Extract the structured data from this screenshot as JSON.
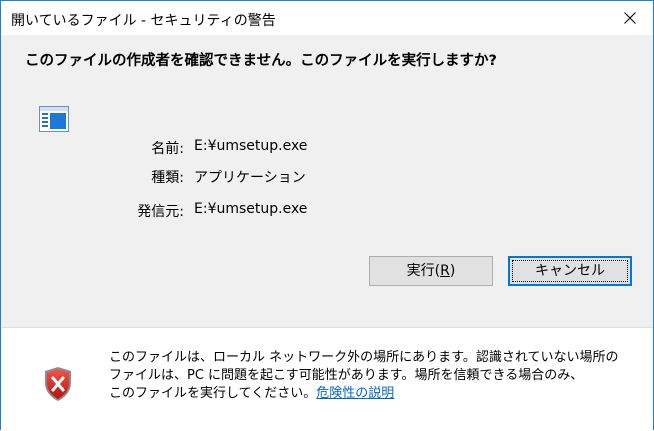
{
  "window": {
    "title": "開いているファイル - セキュリティの警告",
    "close_glyph": "✕"
  },
  "main": {
    "question": "このファイルの作成者を確認できません。このファイルを実行しますか?",
    "fields": [
      {
        "label": "名前:",
        "value": "E:¥umsetup.exe"
      },
      {
        "label": "種類:",
        "value": "アプリケーション"
      },
      {
        "label": "発信元:",
        "value": "E:¥umsetup.exe"
      }
    ]
  },
  "buttons": {
    "run_label": "実行(",
    "run_accel": "R",
    "run_suffix": ")",
    "cancel_label": "キャンセル"
  },
  "warning": {
    "line1": "このファイルは、ローカル ネットワーク外の場所にあります。認識されていない場所の",
    "line2": "ファイルは、PC に問題を起こす可能性があります。場所を信頼できる場合のみ、",
    "line3": "このファイルを実行してください。",
    "link_text": "危険性の説明"
  },
  "colors": {
    "window_border": "#1883d7",
    "content_bg": "#f0f0f0",
    "link": "#0066cc",
    "focus_border": "#0078d7",
    "shield_red": "#d4241c"
  }
}
